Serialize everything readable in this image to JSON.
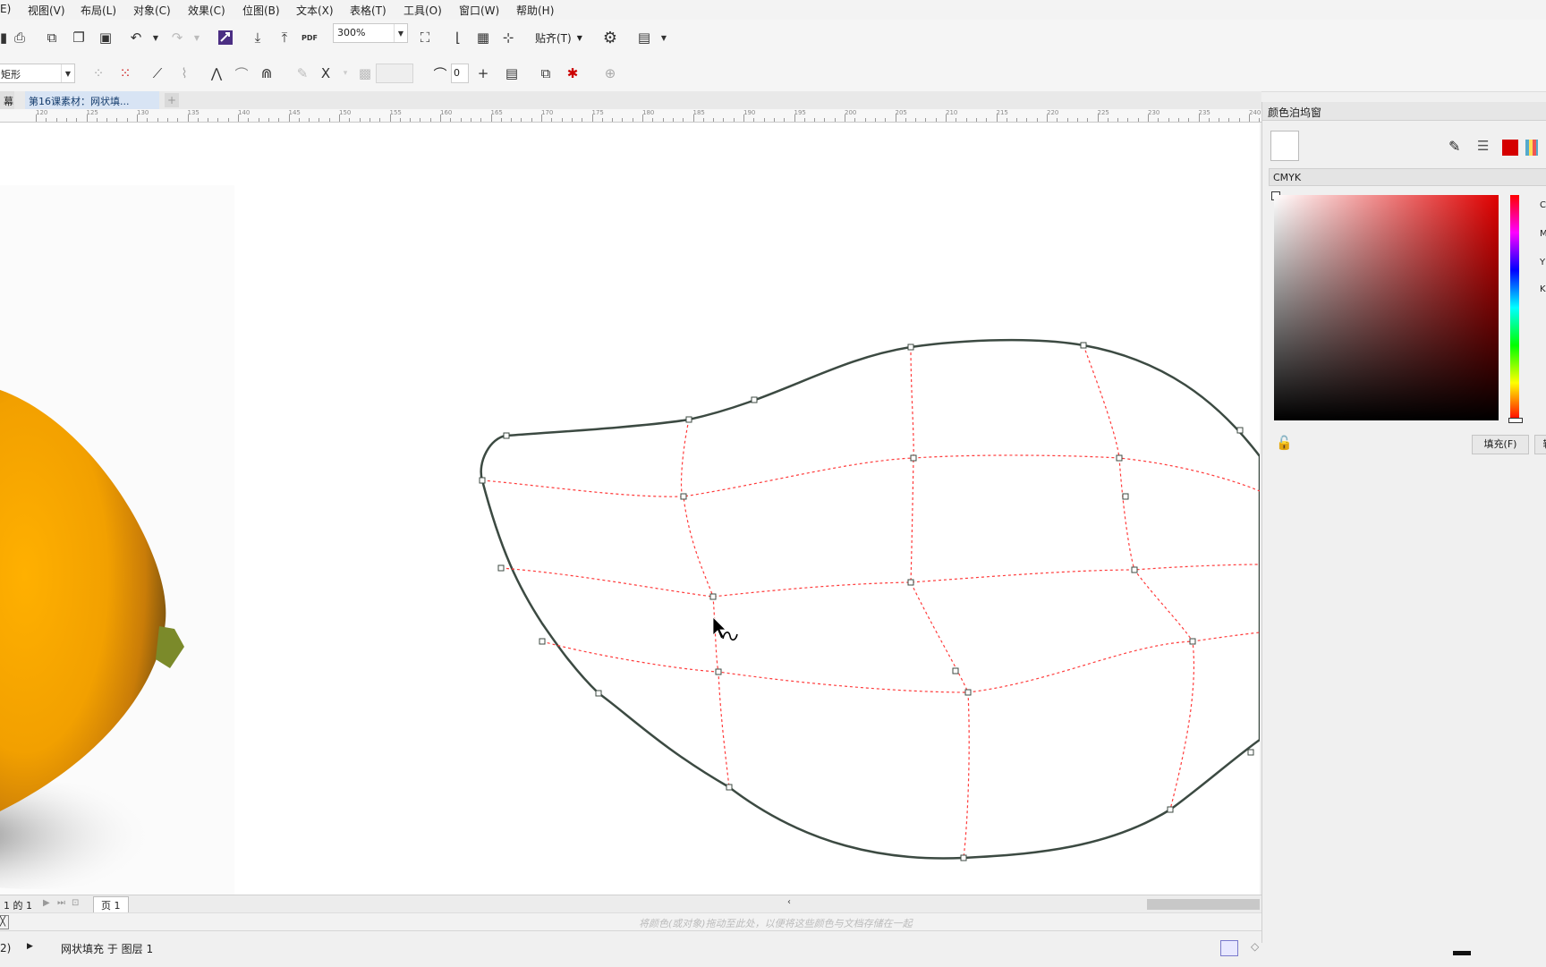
{
  "menu": [
    "E)",
    "视图(V)",
    "布局(L)",
    "对象(C)",
    "效果(C)",
    "位图(B)",
    "文本(X)",
    "表格(T)",
    "工具(O)",
    "窗口(W)",
    "帮助(H)"
  ],
  "toolbar": {
    "zoom_value": "300%",
    "snap_label": "贴齐(T)",
    "pdf_label": "PDF"
  },
  "property_bar": {
    "shape_combo": "矩形",
    "smoothness_value": "0"
  },
  "tabs": {
    "first_tab": "幕",
    "document_tab": "第16课素材：网状填..."
  },
  "ruler_labels": [
    "120",
    "125",
    "130",
    "135",
    "140",
    "145",
    "150",
    "155",
    "160",
    "165",
    "170",
    "175",
    "180",
    "185",
    "190",
    "195",
    "200",
    "205",
    "210",
    "215",
    "220",
    "225",
    "230",
    "235",
    "240"
  ],
  "docker": {
    "title": "颜色泊坞窗",
    "color_model": "CMYK",
    "channels": [
      "C",
      "M",
      "Y",
      "K"
    ],
    "fill_button": "填充(F)",
    "outline_button": "轮"
  },
  "page_nav": {
    "position": "1 的 1",
    "page_tab": "页 1"
  },
  "hint_text": "将颜色(或对象)拖动至此处，以便将这些颜色与文档存储在一起",
  "status": {
    "left": "2)",
    "object_info": "网状填充 于 图层 1"
  },
  "colors": {
    "mesh_line": "#ff3b3b",
    "outline": "#3c4a42",
    "accent": "#d50000",
    "mango": "#f2a000"
  }
}
